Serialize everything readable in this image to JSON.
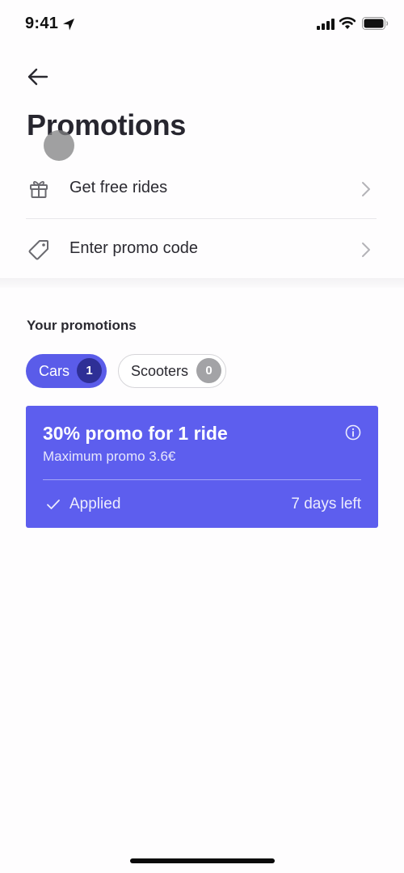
{
  "status_bar": {
    "time": "9:41",
    "icons": [
      "location-arrow-icon",
      "cellular-signal-icon",
      "wifi-icon",
      "battery-icon"
    ]
  },
  "header": {
    "back_icon": "arrow-left-icon",
    "title": "Promotions"
  },
  "menu": [
    {
      "label": "Get free rides",
      "icon": "gift-icon",
      "chevron": "chevron-right-icon"
    },
    {
      "label": "Enter promo code",
      "icon": "tag-icon",
      "chevron": "chevron-right-icon"
    }
  ],
  "your_promotions": {
    "title": "Your promotions",
    "tabs": [
      {
        "label": "Cars",
        "count": "1",
        "selected": true
      },
      {
        "label": "Scooters",
        "count": "0",
        "selected": false
      }
    ],
    "cards": [
      {
        "title": "30% promo for 1 ride",
        "subtitle": "Maximum promo 3.6€",
        "status": "Applied",
        "expiry": "7 days left",
        "info_icon": "info-circle-icon",
        "status_icon": "check-icon"
      }
    ]
  },
  "colors": {
    "accent": "#5d5eee",
    "accent_dark": "#2e2f96",
    "text_primary": "#27262f",
    "badge_inactive": "#a3a3a6"
  }
}
